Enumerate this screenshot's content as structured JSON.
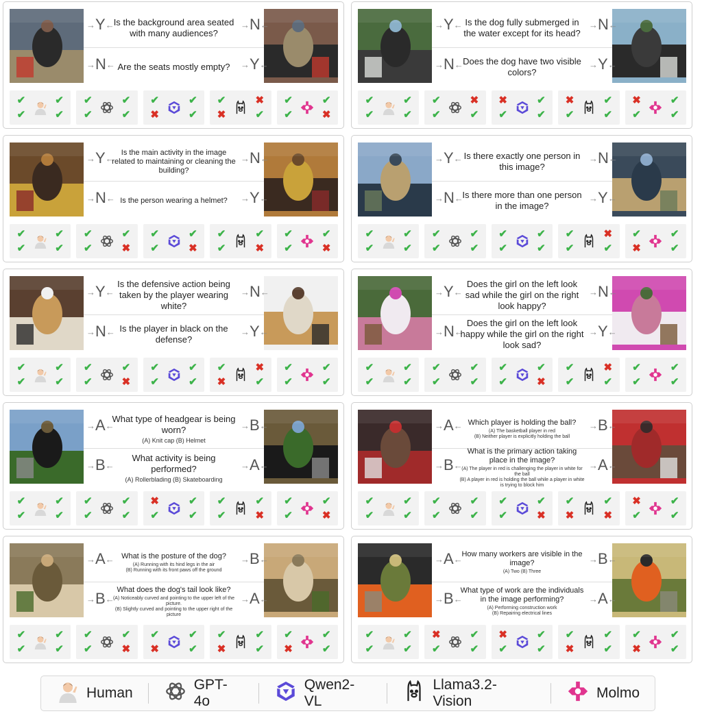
{
  "cards": [
    {
      "type": "yn",
      "q1": "Is the background area seated with many audiences?",
      "q2": "Are the seats mostly empty?",
      "ll": [
        "Y",
        "N"
      ],
      "rl": [
        "N",
        "Y"
      ],
      "img": [
        "#5e6b7a",
        "#9a8b6b",
        "#c03a2e",
        "#2a2a2a",
        "#7a5a4a"
      ],
      "marks": [
        [
          "ok",
          "ok",
          "ok",
          "ok"
        ],
        [
          "ok",
          "ok",
          "ok",
          "ok"
        ],
        [
          "ok",
          "ok",
          "no",
          "ok"
        ],
        [
          "ok",
          "no",
          "no",
          "ok"
        ],
        [
          "ok",
          "ok",
          "ok",
          "no"
        ]
      ]
    },
    {
      "type": "yn",
      "q1": "Is the dog fully submerged in the water except for its head?",
      "q2": "Does the dog have two visible colors?",
      "ll": [
        "Y",
        "N"
      ],
      "rl": [
        "N",
        "Y"
      ],
      "img": [
        "#4a6b3e",
        "#3a3a3a",
        "#d9dcd8",
        "#2a2a2a",
        "#8ab0c8"
      ],
      "marks": [
        [
          "ok",
          "ok",
          "ok",
          "ok"
        ],
        [
          "ok",
          "no",
          "ok",
          "ok"
        ],
        [
          "no",
          "ok",
          "ok",
          "ok"
        ],
        [
          "no",
          "ok",
          "ok",
          "ok"
        ],
        [
          "no",
          "ok",
          "ok",
          "ok"
        ]
      ]
    },
    {
      "type": "yn",
      "q1": "Is the main activity in the image related to maintaining or cleaning the building?",
      "q2": "Is the person wearing a helmet?",
      "ll": [
        "Y",
        "N"
      ],
      "rl": [
        "N",
        "Y"
      ],
      "small": true,
      "img": [
        "#6b4a2a",
        "#c9a23a",
        "#8a2a2a",
        "#3a2a20",
        "#b07a3a"
      ],
      "marks": [
        [
          "ok",
          "ok",
          "ok",
          "ok"
        ],
        [
          "ok",
          "ok",
          "ok",
          "no"
        ],
        [
          "ok",
          "ok",
          "ok",
          "no"
        ],
        [
          "ok",
          "ok",
          "ok",
          "no"
        ],
        [
          "ok",
          "ok",
          "ok",
          "no"
        ]
      ]
    },
    {
      "type": "yn",
      "q1": "Is there exactly one person in this image?",
      "q2": "Is there more than one person in the image?",
      "ll": [
        "Y",
        "N"
      ],
      "rl": [
        "N",
        "Y"
      ],
      "img": [
        "#8aa8c8",
        "#2a3a4a",
        "#6a7a5a",
        "#b9a070",
        "#3a4a5a"
      ],
      "marks": [
        [
          "ok",
          "ok",
          "ok",
          "ok"
        ],
        [
          "ok",
          "ok",
          "ok",
          "ok"
        ],
        [
          "ok",
          "ok",
          "ok",
          "ok"
        ],
        [
          "ok",
          "no",
          "ok",
          "ok"
        ],
        [
          "ok",
          "ok",
          "no",
          "ok"
        ]
      ]
    },
    {
      "type": "yn",
      "q1": "Is the defensive action being taken by the player wearing white?",
      "q2": "Is the player in black on the defense?",
      "ll": [
        "Y",
        "N"
      ],
      "rl": [
        "N",
        "Y"
      ],
      "img": [
        "#5a4030",
        "#e0d8c8",
        "#2a2a2a",
        "#c89a5a",
        "#f0f0f0"
      ],
      "marks": [
        [
          "ok",
          "ok",
          "ok",
          "ok"
        ],
        [
          "ok",
          "ok",
          "ok",
          "no"
        ],
        [
          "ok",
          "ok",
          "ok",
          "ok"
        ],
        [
          "ok",
          "no",
          "no",
          "ok"
        ],
        [
          "ok",
          "ok",
          "ok",
          "ok"
        ]
      ]
    },
    {
      "type": "yn",
      "q1": "Does the girl on the left look sad while the girl on the right look happy?",
      "q2": "Does the girl on the left look happy while the girl on the right look sad?",
      "ll": [
        "Y",
        "N"
      ],
      "rl": [
        "N",
        "Y"
      ],
      "img": [
        "#4a6a3a",
        "#c87a9a",
        "#7a5a3a",
        "#f0eaf0",
        "#d04ab0"
      ],
      "marks": [
        [
          "ok",
          "ok",
          "ok",
          "ok"
        ],
        [
          "ok",
          "ok",
          "ok",
          "ok"
        ],
        [
          "ok",
          "ok",
          "ok",
          "no"
        ],
        [
          "ok",
          "no",
          "ok",
          "ok"
        ],
        [
          "ok",
          "ok",
          "ok",
          "ok"
        ]
      ]
    },
    {
      "type": "ab",
      "q1": "What type of headgear is being worn?",
      "o1": "(A) Knit cap   (B) Helmet",
      "q2": "What activity is being performed?",
      "o2": "(A) Rollerblading  (B) Skateboarding",
      "ll": [
        "A",
        "B"
      ],
      "rl": [
        "B",
        "A"
      ],
      "img": [
        "#7aa0c8",
        "#3a6a2a",
        "#8a8a8a",
        "#1a1a1a",
        "#6a5a3a"
      ],
      "marks": [
        [
          "ok",
          "ok",
          "ok",
          "ok"
        ],
        [
          "ok",
          "ok",
          "ok",
          "ok"
        ],
        [
          "no",
          "ok",
          "ok",
          "ok"
        ],
        [
          "ok",
          "ok",
          "ok",
          "no"
        ],
        [
          "ok",
          "ok",
          "ok",
          "no"
        ]
      ]
    },
    {
      "type": "ab",
      "q1": "Which player is holding the ball?",
      "o1": "(A) The basketball player in red\n(B) Neither player is explicitly holding the ball",
      "q2": "What is the primary action taking place in the image?",
      "o2": "(A) The player in red is challenging the player in white for the ball\n(B) A player in red is holding the ball while a player in white is trying to block him",
      "ll": [
        "A",
        "B"
      ],
      "rl": [
        "B",
        "A"
      ],
      "small": true,
      "img": [
        "#3a2a2a",
        "#a02a2a",
        "#e0e0e0",
        "#6a4a3a",
        "#c03030"
      ],
      "marks": [
        [
          "ok",
          "ok",
          "ok",
          "ok"
        ],
        [
          "ok",
          "ok",
          "ok",
          "ok"
        ],
        [
          "ok",
          "ok",
          "ok",
          "no"
        ],
        [
          "ok",
          "ok",
          "no",
          "no"
        ],
        [
          "no",
          "ok",
          "ok",
          "ok"
        ]
      ]
    },
    {
      "type": "ab",
      "q1": "What is the posture of the dog?",
      "o1": "(A) Running with its hind legs in the air\n(B) Running with its front paws off the ground",
      "q2": "What does the dog's tail look like?",
      "o2": "(A) Noticeably curved and pointing to the upper left of the picture.\n(B) Slightly curved and pointing to the upper right of the picture",
      "ll": [
        "A",
        "B"
      ],
      "rl": [
        "B",
        "A"
      ],
      "small": true,
      "img": [
        "#8a7a5a",
        "#d8c8a8",
        "#4a6a2a",
        "#6a5a3a",
        "#c8a878"
      ],
      "marks": [
        [
          "ok",
          "ok",
          "ok",
          "ok"
        ],
        [
          "ok",
          "ok",
          "ok",
          "no"
        ],
        [
          "ok",
          "ok",
          "no",
          "ok"
        ],
        [
          "ok",
          "ok",
          "no",
          "ok"
        ],
        [
          "ok",
          "ok",
          "no",
          "ok"
        ]
      ]
    },
    {
      "type": "ab",
      "q1": "How many workers are visible in the image?",
      "o1": "(A) Two  (B) Three",
      "q2": "What type of work are the individuals in the image performing?",
      "o2": "(A) Performing construction work\n(B) Repairing electrical lines",
      "ll": [
        "A",
        "B"
      ],
      "rl": [
        "B",
        "A"
      ],
      "small": true,
      "img": [
        "#2a2a2a",
        "#e06020",
        "#8a8a7a",
        "#6a7a3a",
        "#c8b878"
      ],
      "marks": [
        [
          "ok",
          "ok",
          "ok",
          "ok"
        ],
        [
          "no",
          "ok",
          "ok",
          "ok"
        ],
        [
          "no",
          "ok",
          "ok",
          "ok"
        ],
        [
          "ok",
          "ok",
          "no",
          "ok"
        ],
        [
          "ok",
          "ok",
          "no",
          "ok"
        ]
      ]
    }
  ],
  "legend": {
    "human": "Human",
    "gpt": "GPT-4o",
    "qwen": "Qwen2-VL",
    "llama": "Llama3.2-Vision",
    "molmo": "Molmo"
  },
  "colors": {
    "ok": "#3db34a",
    "no": "#d93025",
    "qwen": "#5b4ad8",
    "molmo": "#e0358f"
  },
  "glyphs": {
    "ok": "✔",
    "no": "✖"
  }
}
